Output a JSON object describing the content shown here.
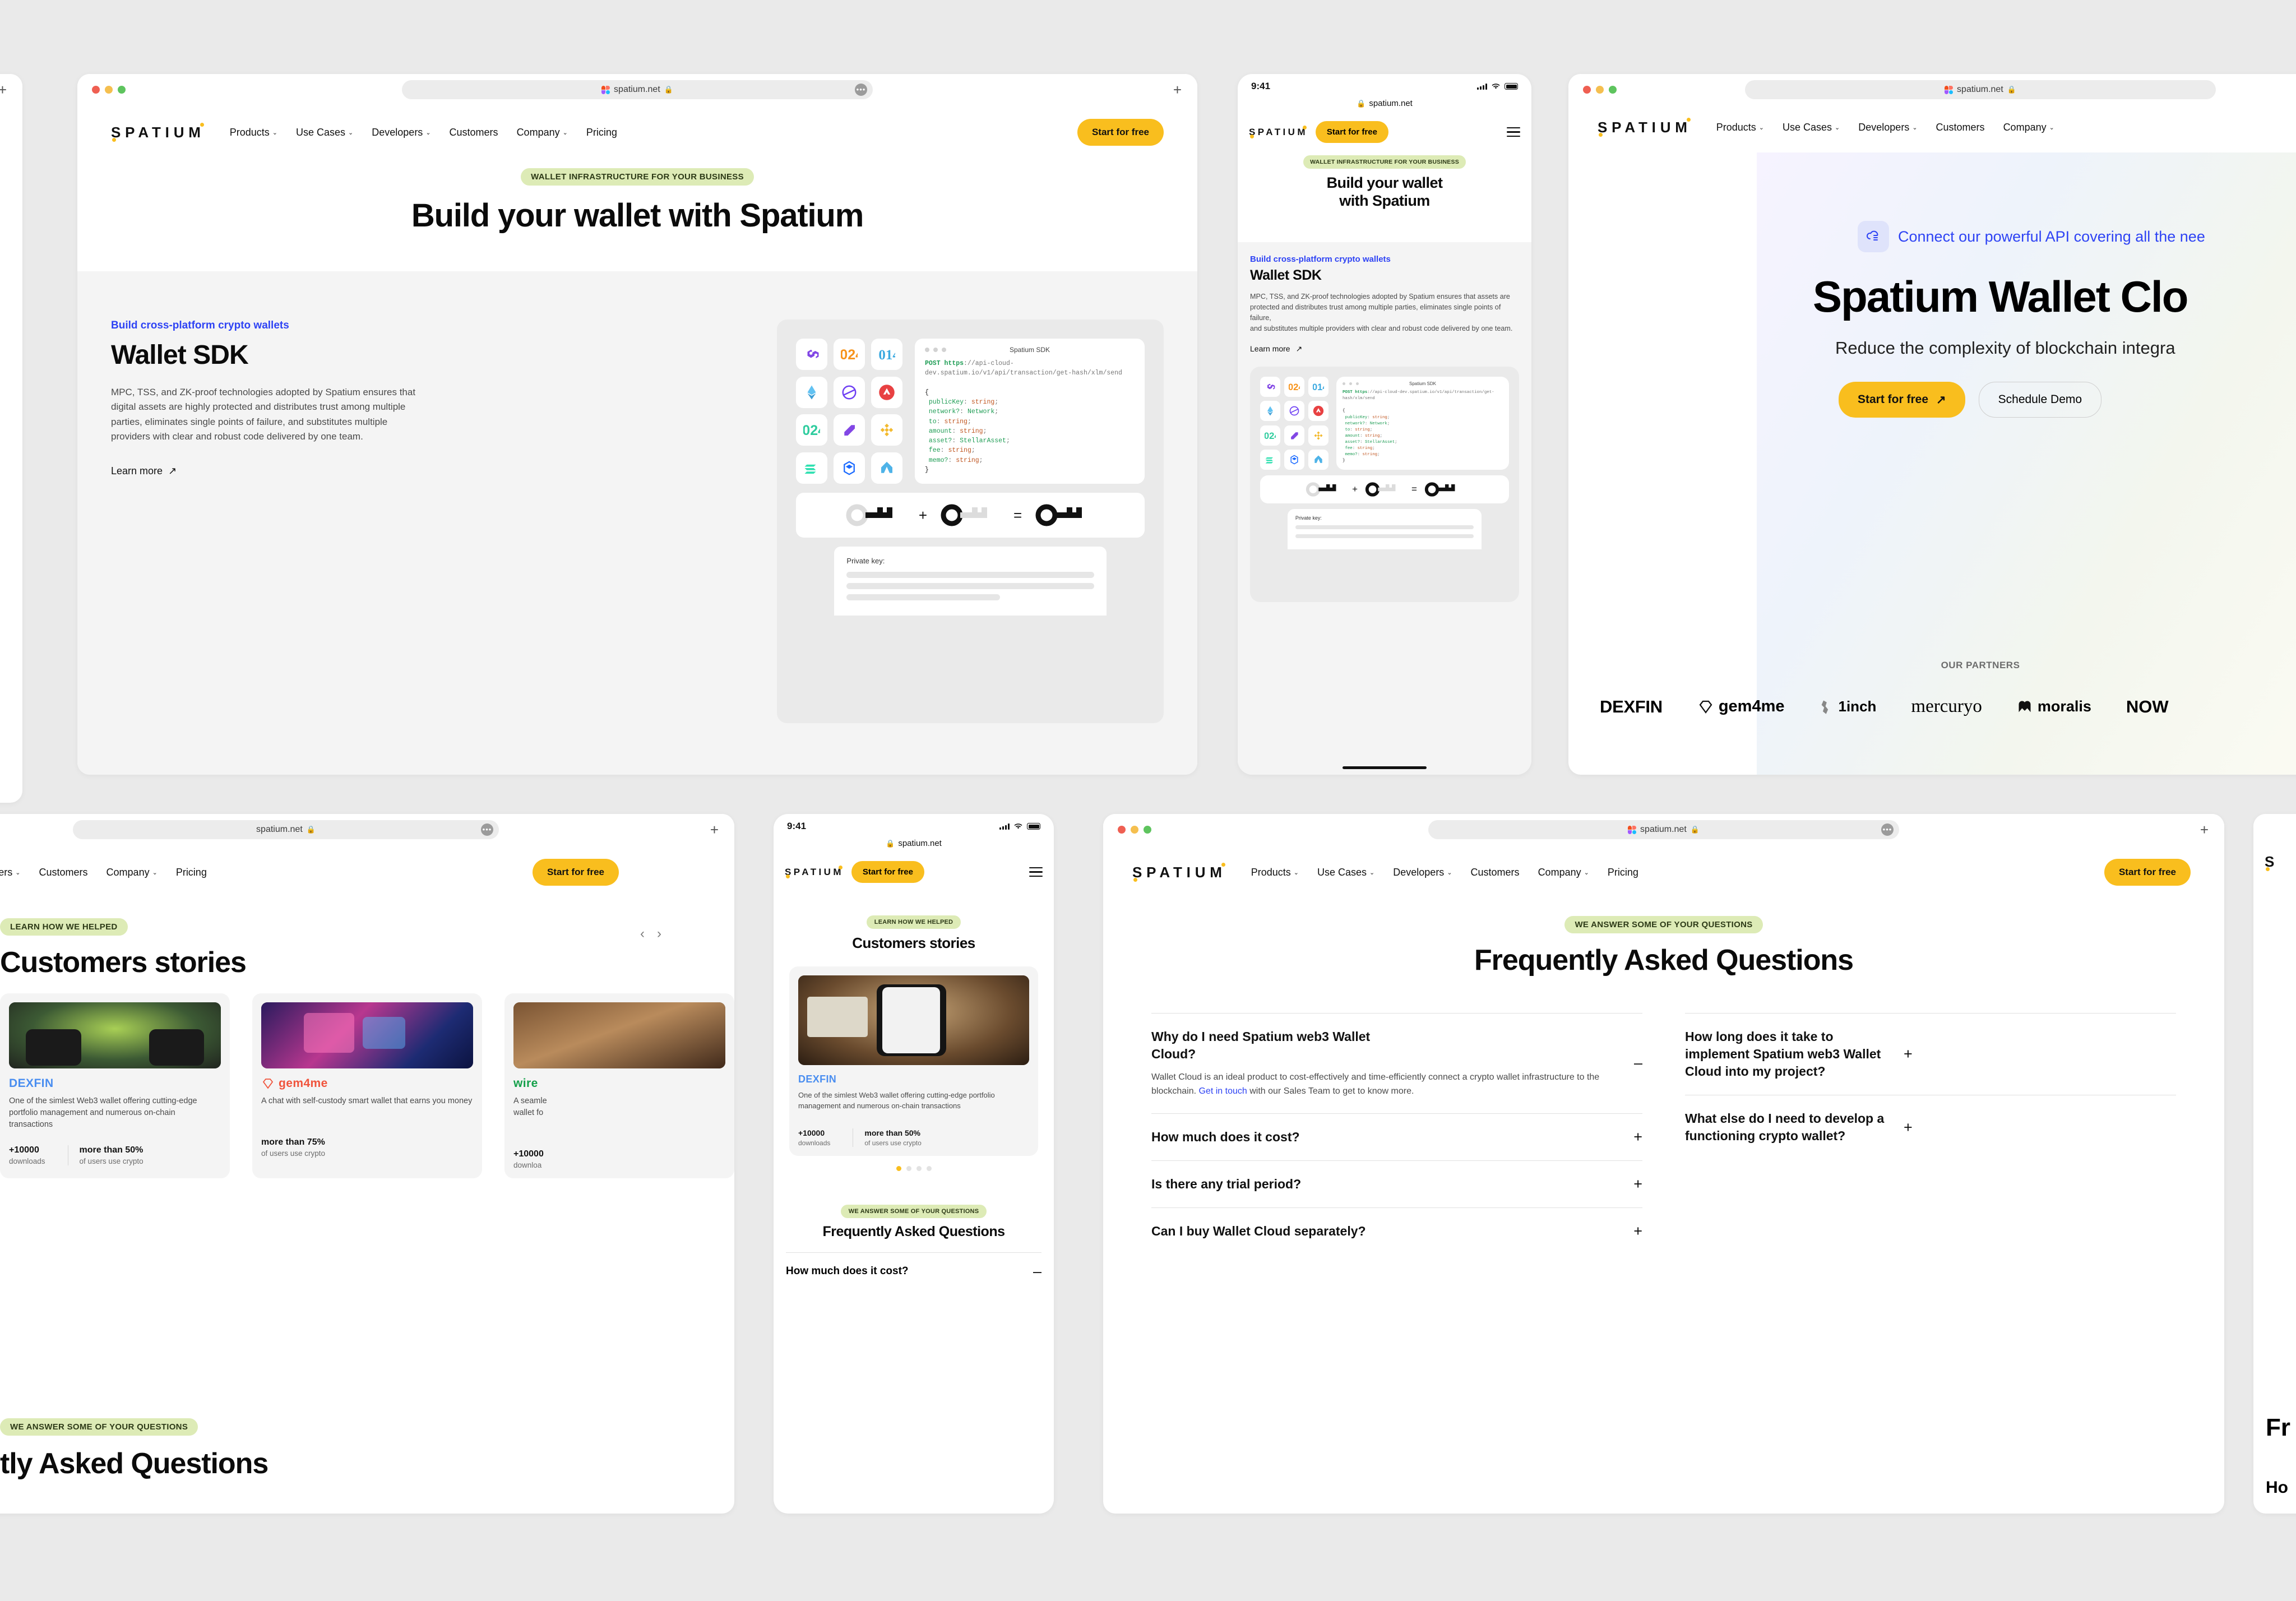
{
  "brand": {
    "name": "SPATIUM",
    "accent": "#F9BE1E",
    "blue": "#2E43F4",
    "badge_bg": "#DDEBB6"
  },
  "browser": {
    "url": "spatium.net",
    "lock": "🔒",
    "more": "•••",
    "plus": "+"
  },
  "nav": {
    "items": [
      {
        "label": "Products",
        "caret": "⌄"
      },
      {
        "label": "Use Cases",
        "caret": "⌄"
      },
      {
        "label": "Developers",
        "caret": "⌄"
      },
      {
        "label": "Customers",
        "caret": ""
      },
      {
        "label": "Company",
        "caret": "⌄"
      },
      {
        "label": "Pricing",
        "caret": ""
      }
    ],
    "cta": "Start for free"
  },
  "panel_sdk": {
    "hero_badge": "WALLET INFRASTRUCTURE FOR YOUR BUSINESS",
    "hero_title": "Build your wallet with Spatium",
    "eyebrow": "Build cross-platform crypto wallets",
    "title": "Wallet SDK",
    "body": "MPC, TSS, and ZK-proof technologies adopted by Spatium ensures that digital assets are highly protected and distributes trust among multiple parties, eliminates single points of failure, and substitutes multiple providers with clear and robust code delivered by one team.",
    "learn_more": "Learn more",
    "arrow": "↗"
  },
  "sdk_graphic": {
    "code_title": "Spatium SDK",
    "code_method": "POST",
    "code_scheme": "https",
    "code_url": "://api-cloud-dev.spatium.io/v1/api/transaction/get-hash/xlm/send",
    "code_lines": [
      {
        "prop": "publicKey",
        "type": "string"
      },
      {
        "prop": "network?",
        "type": "Network"
      },
      {
        "prop": "to",
        "type": "string"
      },
      {
        "prop": "amount",
        "type": "string"
      },
      {
        "prop": "asset?",
        "type": "StellarAsset"
      },
      {
        "prop": "fee",
        "type": "string"
      },
      {
        "prop": "memo?",
        "type": "string"
      }
    ],
    "key_equation": {
      "plus": "+",
      "equals": "="
    },
    "private_key_label": "Private key:",
    "coins": [
      "polygon",
      "bitcoin",
      "litecoin",
      "ethereum",
      "stellar",
      "avalanche",
      "bitcoin-cash",
      "arbitrum-nova",
      "bnb",
      "solana",
      "fantom",
      "aptos"
    ]
  },
  "panel_mobile_sdk": {
    "time": "9:41",
    "url": "spatium.net",
    "cta": "Start for free",
    "hero_badge": "WALLET INFRASTRUCTURE FOR YOUR BUSINESS",
    "hero_title_l1": "Build your wallet",
    "hero_title_l2": "with Spatium",
    "eyebrow": "Build cross-platform crypto wallets",
    "title": "Wallet SDK",
    "body": "MPC, TSS, and ZK-proof technologies adopted by Spatium ensures that  assets are protected and distributes trust among multiple parties, eliminates single points of failure,\nand substitutes multiple providers with clear and robust code delivered by one team.",
    "learn_more": "Learn more",
    "arrow": "↗"
  },
  "panel_cloud": {
    "api_note": "Connect our powerful API covering all the nee",
    "title": "Spatium Wallet Clo",
    "subtitle": "Reduce the complexity of blockchain integra",
    "cta_primary": "Start for free",
    "cta_primary_arrow": "↗",
    "cta_secondary": "Schedule Demo",
    "partners_label": "OUR PARTNERS",
    "partners": [
      "DEXFIN",
      "gem4me",
      "1inch",
      "mercuryo",
      "moralis",
      "NOW"
    ]
  },
  "panel_stories": {
    "badge": "LEARN HOW WE HELPED",
    "title": "Customers stories",
    "prev": "‹",
    "next": "›",
    "faq_badge": "WE ANSWER SOME OF YOUR QUESTIONS",
    "faq_title_clipped": "tly Asked Questions",
    "cards": [
      {
        "brand": "DEXFIN",
        "brand_color": "#4A8EF0",
        "text": "One of the simlest Web3 wallet offering cutting-edge portfolio management and numerous on-chain transactions",
        "stats": [
          {
            "big": "+10000",
            "small": "downloads"
          },
          {
            "big": "more than 50%",
            "small": "of users use crypto"
          }
        ]
      },
      {
        "brand": "gem4me",
        "brand_color": "#F0543C",
        "text": "A chat with self-custody smart wallet that earns you money",
        "stats": [
          {
            "big": "more than 75%",
            "small": "of users use crypto"
          }
        ]
      },
      {
        "brand": "wire",
        "brand_color": "#14A04A",
        "text": "A seamle\nwallet fo",
        "stats": [
          {
            "big": "+10000",
            "small": "downloa"
          }
        ]
      }
    ]
  },
  "panel_mobile_stories": {
    "time": "9:41",
    "url": "spatium.net",
    "cta": "Start for free",
    "badge": "LEARN HOW WE HELPED",
    "title": "Customers stories",
    "card": {
      "brand": "DEXFIN",
      "text": "One of the simlest Web3 wallet offering cutting-edge portfolio management and numerous on-chain transactions",
      "stats": [
        {
          "big": "+10000",
          "small": "downloads"
        },
        {
          "big": "more than 50%",
          "small": "of users use crypto"
        }
      ]
    },
    "pager_active": 0,
    "pager_count": 4,
    "faq_badge": "WE ANSWER SOME OF YOUR QUESTIONS",
    "faq_title": "Frequently Asked Questions",
    "faq_first": "How much does it cost?",
    "faq_first_sign": "–"
  },
  "panel_faq": {
    "badge": "WE ANSWER SOME OF YOUR QUESTIONS",
    "title": "Frequently Asked Questions",
    "left_items": [
      {
        "q": "Why do I need Spatium web3 Wallet Cloud?",
        "sign": "–",
        "answer_1": "Wallet Cloud is an ideal product to cost-effectively and time-efficiently connect a crypto wallet infrastructure to the blockchain. ",
        "answer_link": "Get in touch",
        "answer_2": " with our Sales Team to get to know more."
      },
      {
        "q": "How much does it cost?",
        "sign": "+"
      },
      {
        "q": "Is there any trial period?",
        "sign": "+"
      },
      {
        "q": "Can I buy Wallet Cloud separately?",
        "sign": "+"
      }
    ],
    "right_items": [
      {
        "q": "How long does it take to implement Spatium web3 Wallet Cloud into my project?",
        "sign": "+"
      },
      {
        "q": "What else do I need to develop a functioning crypto wallet?",
        "sign": "+"
      }
    ]
  },
  "panel_right_edge": {
    "letter": "S",
    "faq_clipped_1": "Fr",
    "faq_clipped_2": "Ho"
  }
}
